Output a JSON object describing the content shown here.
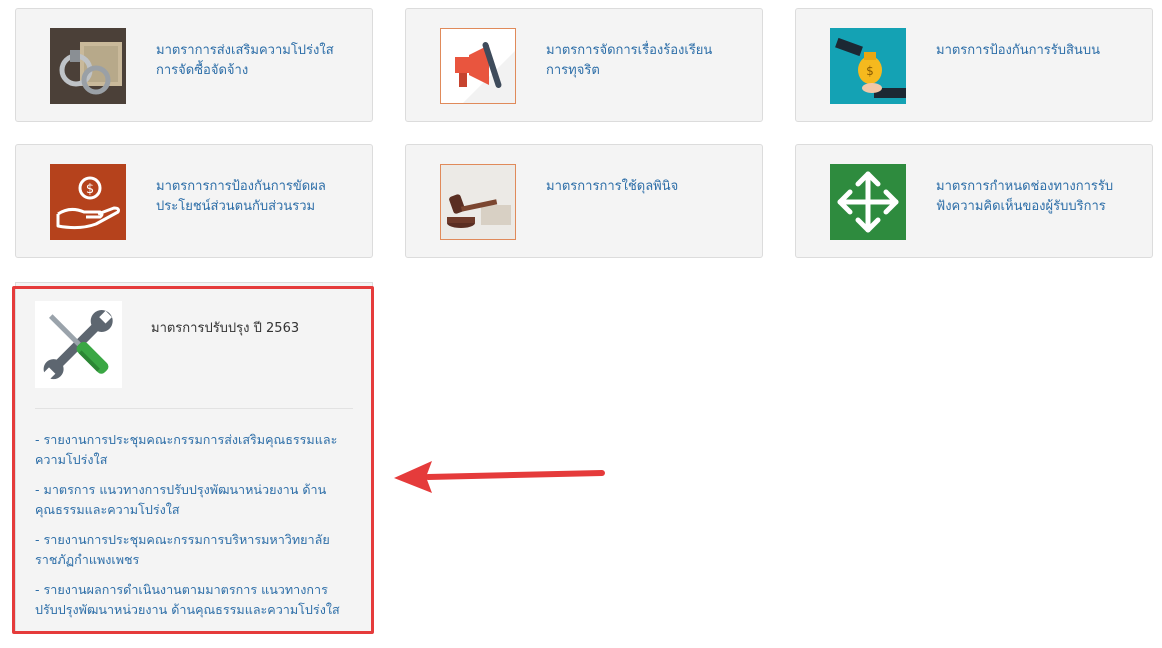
{
  "cards": [
    {
      "title_line1": "มาตราการส่งเสริมความโปร่งใส",
      "title_line2": "การจัดซื้อจัดจ้าง",
      "icon": "handcuffs-money-icon"
    },
    {
      "title_line1": "มาตรการจัดการเรื่องร้องเรียน",
      "title_line2": "การทุจริต",
      "icon": "megaphone-icon"
    },
    {
      "title_line1": "มาตรการป้องกันการรับสินบน",
      "title_line2": "",
      "icon": "bribe-money-bag-icon"
    },
    {
      "title_line1": "มาตรการการป้องกันการขัดผล",
      "title_line2": "ประโยชน์ส่วนตนกับส่วนรวม",
      "icon": "hand-coin-icon"
    },
    {
      "title_line1": "มาตรการการใช้ดุลพินิจ",
      "title_line2": "",
      "icon": "gavel-icon"
    },
    {
      "title_line1": "มาตรการกำหนดช่องทางการรับ",
      "title_line2": "ฟังความคิดเห็นของผู้รับบริการ",
      "icon": "four-way-arrows-icon"
    }
  ],
  "featured": {
    "title": "มาตรการปรับปรุง ปี 2563",
    "icon": "wrench-screwdriver-icon",
    "links": [
      {
        "line1": "- รายงานการประชุมคณะกรรมการส่งเสริมคุณธรรมและ",
        "line2": "ความโปร่งใส"
      },
      {
        "line1": "- มาตรการ แนวทางการปรับปรุงพัฒนาหน่วยงาน ด้าน",
        "line2": "คุณธรรมและความโปร่งใส"
      },
      {
        "line1": "- รายงานการประชุมคณะกรรมการบริหารมหาวิทยาลัย",
        "line2": "ราชภัฏกำแพงเพชร"
      },
      {
        "line1": "- รายงานผลการดำเนินงานตามมาตรการ แนวทางการ",
        "line2": "ปรับปรุงพัฒนาหน่วยงาน ด้านคุณธรรมและความโปร่งใส"
      }
    ]
  },
  "colors": {
    "link": "#2d6ea8",
    "highlight": "#e53b3b",
    "card_bg": "#f4f4f4"
  }
}
